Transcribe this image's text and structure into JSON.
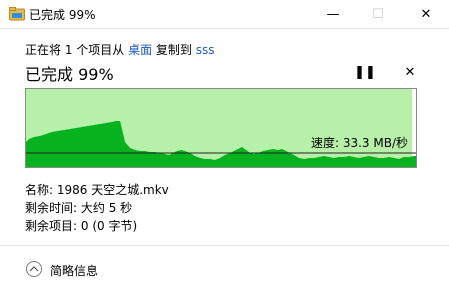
{
  "window": {
    "title": "已完成 99%",
    "minimize_glyph": "—",
    "maximize_glyph": "☐",
    "close_glyph": "✕"
  },
  "copy": {
    "prefix": "正在将 1 个项目从 ",
    "source": "桌面",
    "middle": " 复制到 ",
    "dest": "sss"
  },
  "progress": {
    "heading": "已完成 99%",
    "percent": 99,
    "pause_glyph": "❚❚",
    "cancel_glyph": "✕",
    "speed_text": "速度: 33.3 MB/秒"
  },
  "colors": {
    "progress_fill": "#b7f0a8",
    "progress_bright": "#99e58c",
    "graph_fill": "#06b21d"
  },
  "details": {
    "name_label": "名称:",
    "name_value": "1986 天空之城.mkv",
    "time_label": "剩余时间:",
    "time_value": "大约 5 秒",
    "items_label": "剩余项目:",
    "items_value": "0 (0 字节)"
  },
  "footer": {
    "toggle_label": "简略信息",
    "toggle_icon": "chevron-up-icon"
  }
}
